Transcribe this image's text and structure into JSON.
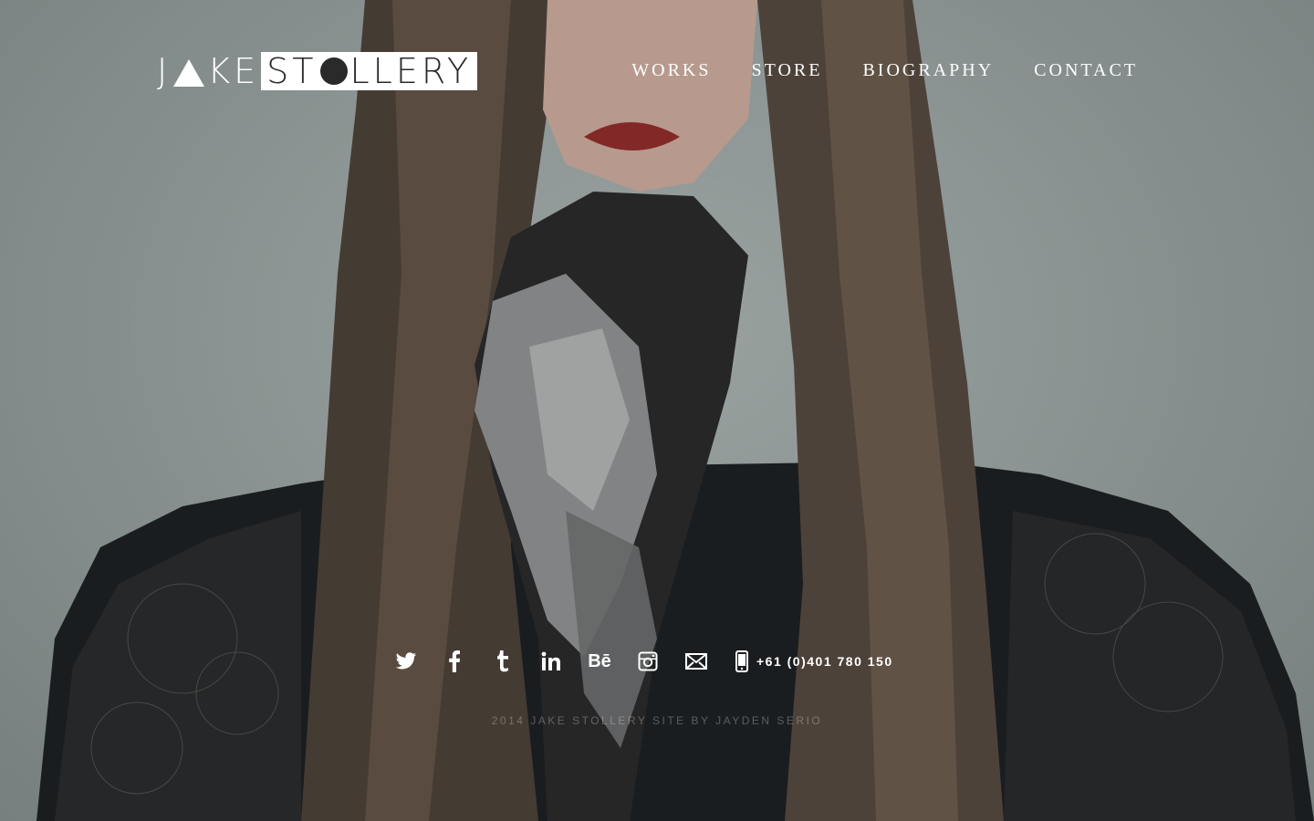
{
  "brand": {
    "logo_left": "J",
    "logo_left_2": "KE",
    "logo_right_1": "ST",
    "logo_right_2": "LLERY"
  },
  "nav": {
    "items": [
      {
        "label": "WORKS"
      },
      {
        "label": "STORE"
      },
      {
        "label": "BIOGRAPHY"
      },
      {
        "label": "CONTACT"
      }
    ]
  },
  "social": {
    "icons": [
      "twitter-icon",
      "facebook-icon",
      "tumblr-icon",
      "linkedin-icon",
      "behance-icon",
      "instagram-icon",
      "email-icon",
      "phone-icon"
    ],
    "behance_label": "Bē",
    "phone": "+61 (0)401 780 150"
  },
  "footer": {
    "text": "2014 JAKE STOLLERY SITE BY JAYDEN SERIO"
  },
  "colors": {
    "text": "#ffffff",
    "background": "#9aa4a2",
    "dark": "#1c1c1c"
  }
}
